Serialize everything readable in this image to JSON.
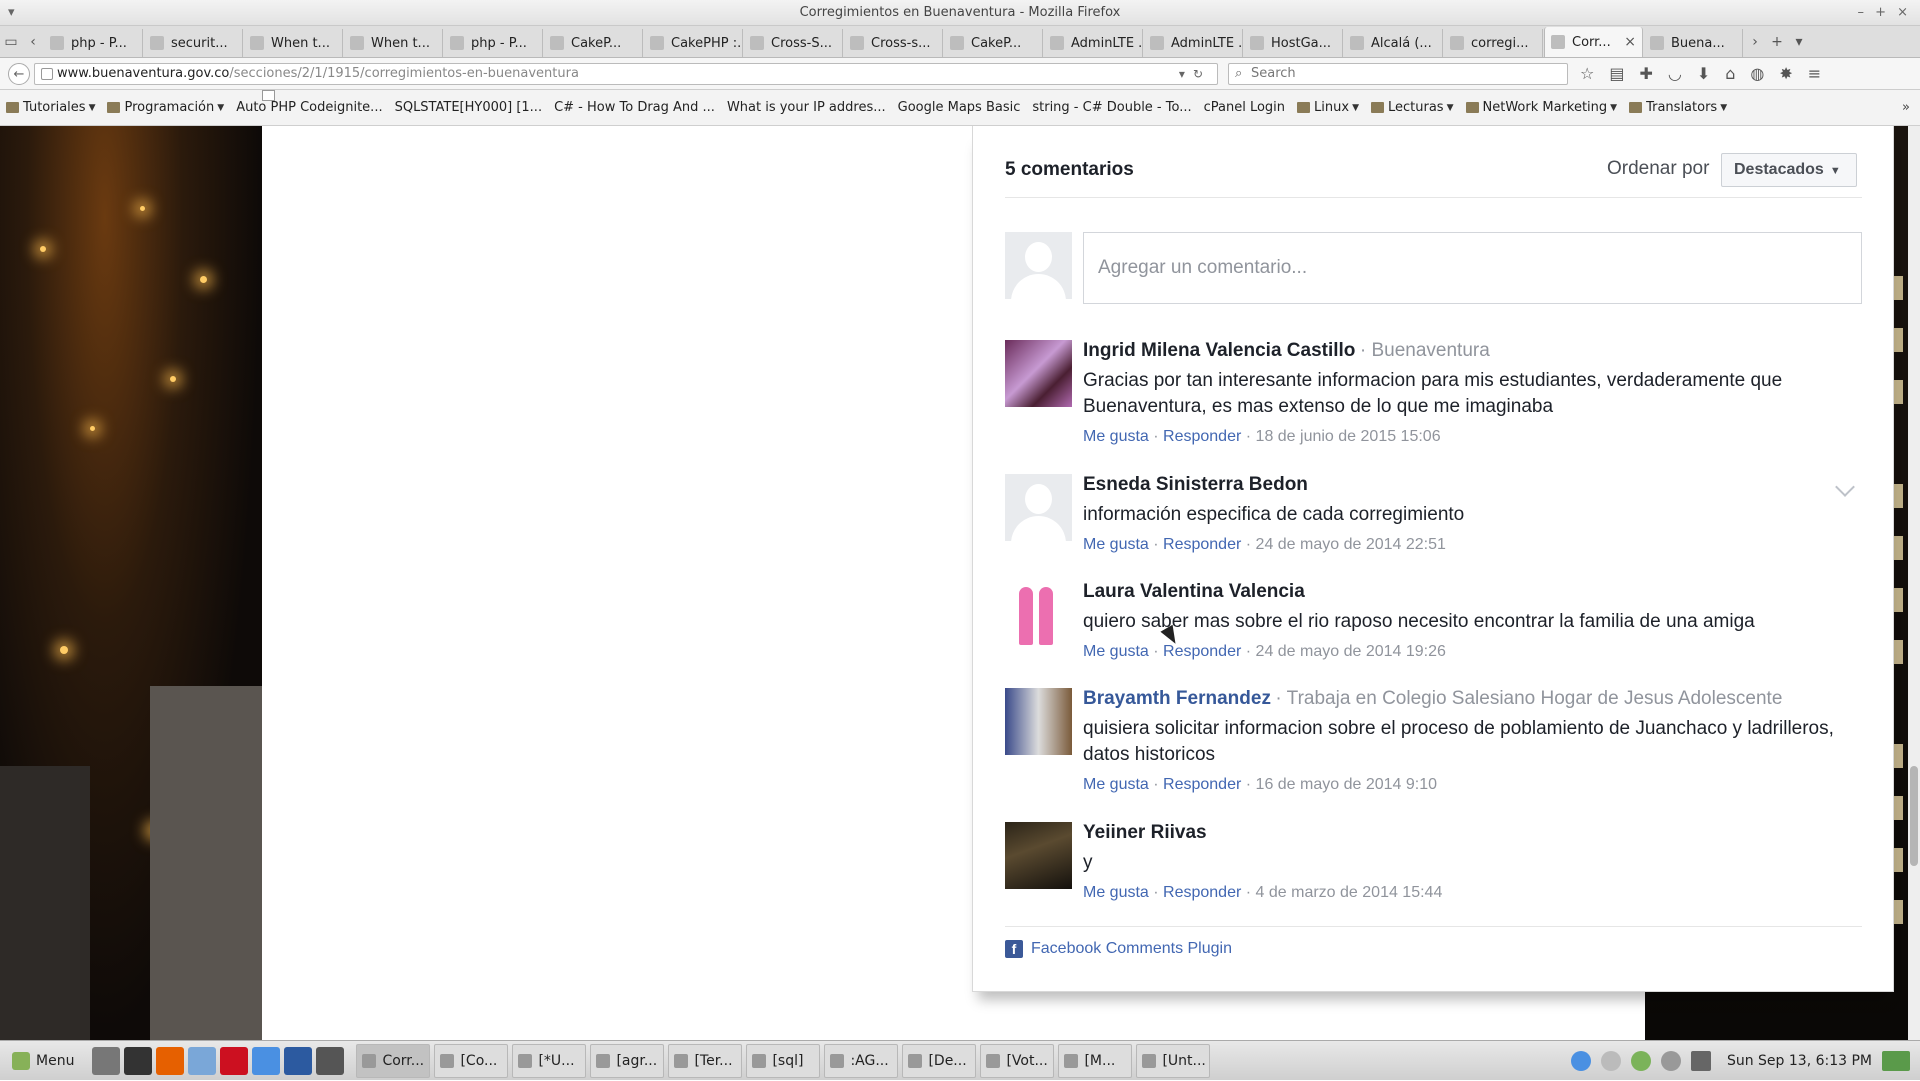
{
  "window": {
    "title": "Corregimientos en Buenaventura - Mozilla Firefox"
  },
  "tabs": [
    {
      "label": "php - P...",
      "icon": "page-icon"
    },
    {
      "label": "securit...",
      "icon": "page-icon"
    },
    {
      "label": "When t...",
      "icon": "page-icon"
    },
    {
      "label": "When t...",
      "icon": "page-icon"
    },
    {
      "label": "php - P...",
      "icon": "page-icon"
    },
    {
      "label": "CakeP...",
      "icon": "cake-icon"
    },
    {
      "label": "CakePHP :...",
      "icon": "page-icon"
    },
    {
      "label": "Cross-S...",
      "icon": "page-icon"
    },
    {
      "label": "Cross-s...",
      "icon": "page-icon"
    },
    {
      "label": "CakeP...",
      "icon": "n-icon"
    },
    {
      "label": "AdminLTE ...",
      "icon": "page-icon"
    },
    {
      "label": "AdminLTE ...",
      "icon": "page-icon"
    },
    {
      "label": "HostGa...",
      "icon": "page-icon"
    },
    {
      "label": "Alcalá (...",
      "icon": "wikipedia-icon"
    },
    {
      "label": "corregi...",
      "icon": "google-icon"
    },
    {
      "label": "Corr...",
      "icon": "page-icon",
      "active": true
    },
    {
      "label": "Buena...",
      "icon": "wikipedia-icon"
    }
  ],
  "navbar": {
    "url_domain": "www.buenaventura.gov.co",
    "url_path": "/secciones/2/1/1915/corregimientos-en-buenaventura",
    "search_placeholder": "Search"
  },
  "bookmarks": [
    {
      "label": "Tutoriales",
      "folder": true,
      "menu": true
    },
    {
      "label": "Programación",
      "folder": true,
      "menu": true
    },
    {
      "label": "Auto PHP Codeignite...",
      "folder": false
    },
    {
      "label": "SQLSTATE[HY000] [1...",
      "folder": false
    },
    {
      "label": "C# - How To Drag And ...",
      "folder": false
    },
    {
      "label": "What is your IP addres...",
      "folder": false
    },
    {
      "label": "Google Maps Basic",
      "folder": false
    },
    {
      "label": "string - C# Double - To...",
      "folder": false
    },
    {
      "label": "cPanel Login",
      "folder": false
    },
    {
      "label": "Linux",
      "folder": true,
      "menu": true
    },
    {
      "label": "Lecturas",
      "folder": true,
      "menu": true
    },
    {
      "label": "NetWork Marketing",
      "folder": true,
      "menu": true
    },
    {
      "label": "Translators",
      "folder": true,
      "menu": true
    }
  ],
  "comments_box": {
    "count_label": "5 comentarios",
    "sort_label": "Ordenar por",
    "sort_value": "Destacados",
    "compose_placeholder": "Agregar un comentario...",
    "comments": [
      {
        "name": "Ingrid Milena Valencia Castillo",
        "meta": "· Buenaventura",
        "text": "Gracias por tan interesante informacion para mis estudiantes, verdaderamente que Buenaventura, es mas extenso de lo que me imaginaba",
        "like": "Me gusta",
        "reply": "Responder",
        "date": "· 18 de junio de 2015 15:06"
      },
      {
        "name": "Esneda Sinisterra Bedon",
        "meta": "",
        "text": "información especifica de cada corregimiento",
        "like": "Me gusta",
        "reply": "Responder",
        "date": "· 24 de mayo de 2014 22:51"
      },
      {
        "name": "Laura Valentina Valencia",
        "meta": "",
        "text": "quiero saber mas sobre el rio raposo necesito encontrar la familia de una amiga",
        "like": "Me gusta",
        "reply": "Responder",
        "date": "· 24 de mayo de 2014 19:26"
      },
      {
        "name": "Brayamth Fernandez",
        "meta": "· Trabaja en Colegio Salesiano Hogar de Jesus Adolescente",
        "text": "quisiera solicitar informacion sobre el proceso de poblamiento de Juanchaco y ladrilleros, datos historicos",
        "like": "Me gusta",
        "reply": "Responder",
        "date": "· 16 de mayo de 2014 9:10"
      },
      {
        "name": "Yeiiner Riivas",
        "meta": "",
        "text": "y",
        "like": "Me gusta",
        "reply": "Responder",
        "date": "· 4 de marzo de 2014 15:44"
      }
    ],
    "plugin_label": "Facebook Comments Plugin"
  },
  "taskbar": {
    "menu_label": "Menu",
    "tasks": [
      "Corr...",
      "[Co...",
      "[*U...",
      "[agr...",
      "[Ter...",
      "[sql]",
      ":AG...",
      "[De...",
      "[Vot...",
      "[M...",
      "[Unt..."
    ],
    "clock": "Sun Sep 13,  6:13 PM"
  },
  "colors": {
    "link": "#4267b2",
    "name_link": "#365899",
    "muted": "#90949c"
  }
}
